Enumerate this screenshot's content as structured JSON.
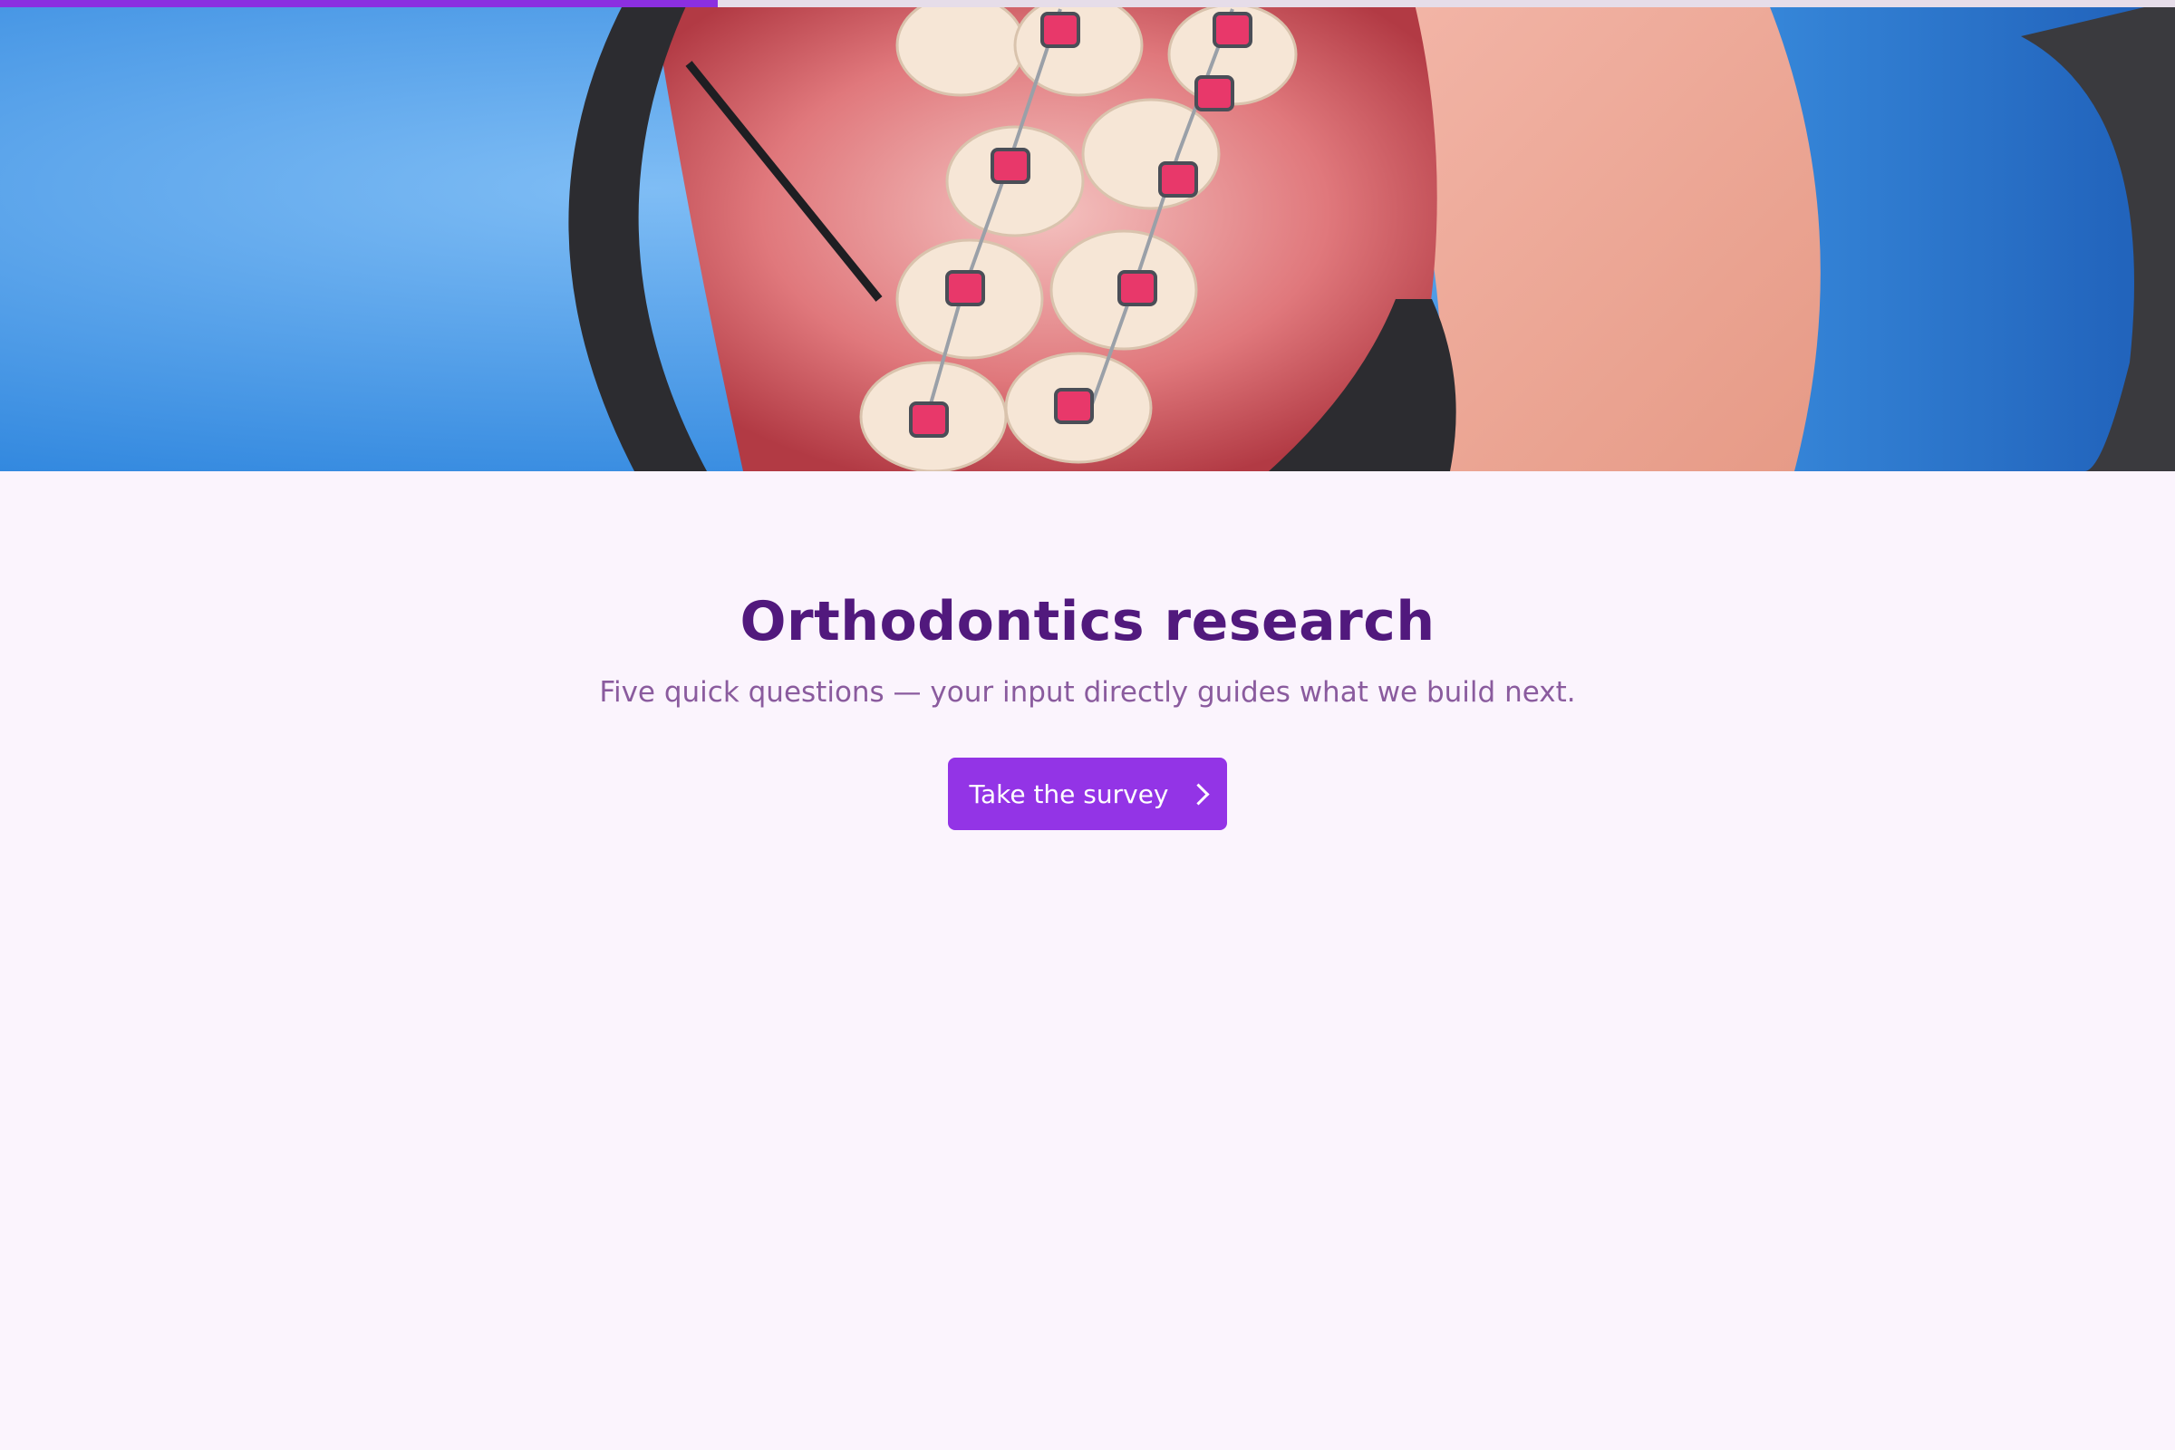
{
  "page": {
    "title": "Orthodontics research",
    "subtitle": "Five quick questions — your input directly guides what we build next."
  },
  "progress": {
    "fraction": 0.33
  },
  "hero": {
    "image": "close-up photo of teeth with orthodontic braces held open by a dental retractor"
  },
  "cta": {
    "label": "Take the survey",
    "icon": "chevron-right-icon"
  },
  "colors": {
    "accent": "#9334e6",
    "title": "#51197d",
    "subtitle": "#8a5b9e",
    "background": "#fbf4fd"
  }
}
